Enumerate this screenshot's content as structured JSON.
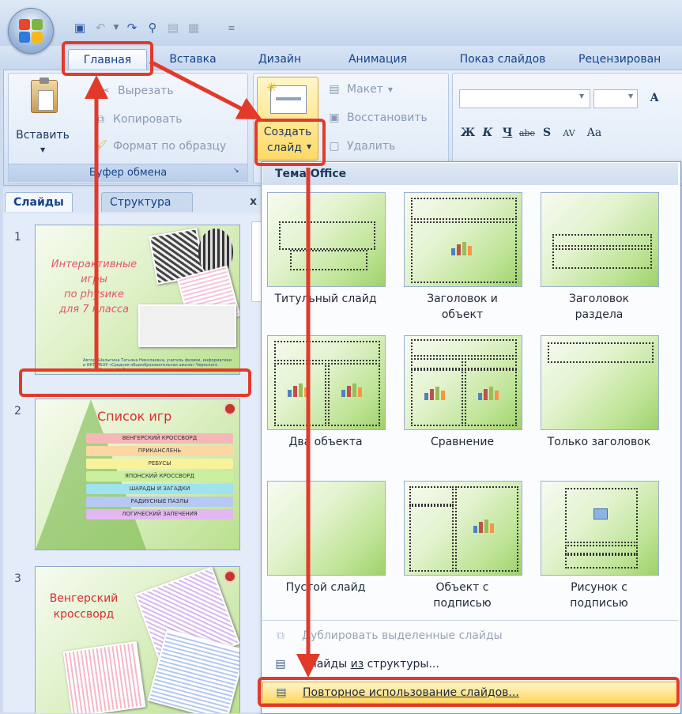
{
  "quick_access": {
    "icons": [
      "save-icon",
      "undo-icon",
      "redo-icon",
      "print-preview-icon",
      "format-icon",
      "layout-icon"
    ]
  },
  "tabs": [
    "Главная",
    "Вставка",
    "Дизайн",
    "Анимация",
    "Показ слайдов",
    "Рецензирован"
  ],
  "clipboard": {
    "paste": "Вставить",
    "cut": "Вырезать",
    "copy": "Копировать",
    "format_painter": "Формат по образцу",
    "group_label": "Буфер обмена"
  },
  "slides_group": {
    "create_line1": "Создать",
    "create_line2": "слайд",
    "layout": "Макет",
    "reset": "Восстановить",
    "delete": "Удалить"
  },
  "font_group": {
    "bold": "Ж",
    "italic": "К",
    "underline": "Ч",
    "strike": "abe",
    "shadow": "S",
    "spacing": "AV",
    "case": "Aa",
    "grow": "A"
  },
  "left_panel": {
    "tab_slides": "Слайды",
    "tab_outline": "Структура",
    "close": "x",
    "slides": [
      {
        "number": "1",
        "title_lines": [
          "Интерактивные игры",
          "по physике",
          "для 7 класса"
        ],
        "author": "Автор: Шалыгина Татьяна Николаевна, учитель физики, информатики и ИКТ МБОУ «Средняя общеобразовательная школа» Чернского района Брянской области"
      },
      {
        "number": "2",
        "title": "Список игр",
        "items": [
          "ВЕНГЕРСКИЙ КРОССВОРД",
          "ПРИКАНСЛЕНЬ",
          "РЕБУСЫ",
          "ЯПОНСКИЙ КРОССВОРД",
          "ШАРАДЫ И ЗАГАДКИ",
          "РАДИУСНЫЕ ПАЗЛЫ",
          "ЛОГИЧЕСКИЙ ЗАПЕЧЕНИЯ"
        ],
        "item_colors": [
          "#f6b7b7",
          "#fbd8a1",
          "#f8f39b",
          "#c9ef9f",
          "#9fe3ee",
          "#b7c8f4",
          "#e3b8f1"
        ]
      },
      {
        "number": "3",
        "title_lines": [
          "Венгерский",
          "кроссворд"
        ]
      }
    ]
  },
  "dropdown": {
    "header": "Тема Office",
    "layouts": [
      {
        "label_lines": [
          "Титульный слайд"
        ]
      },
      {
        "label_lines": [
          "Заголовок и",
          "объект"
        ]
      },
      {
        "label_lines": [
          "Заголовок",
          "раздела"
        ]
      },
      {
        "label_lines": [
          "Два объекта"
        ]
      },
      {
        "label_lines": [
          "Сравнение"
        ]
      },
      {
        "label_lines": [
          "Только заголовок"
        ]
      },
      {
        "label_lines": [
          "Пустой слайд"
        ]
      },
      {
        "label_lines": [
          "Объект с",
          "подписью"
        ]
      },
      {
        "label_lines": [
          "Рисунок с",
          "подписью"
        ]
      }
    ],
    "menu": [
      {
        "label": "Дублировать выделенные слайды",
        "enabled": false
      },
      {
        "label_pre": "Слайды ",
        "label_u": "из",
        "label_post": " структуры...",
        "enabled": true
      },
      {
        "label": "Повторное использование слайдов...",
        "enabled": true,
        "highlighted": true
      }
    ]
  },
  "annotation_color": "#e23a2a"
}
